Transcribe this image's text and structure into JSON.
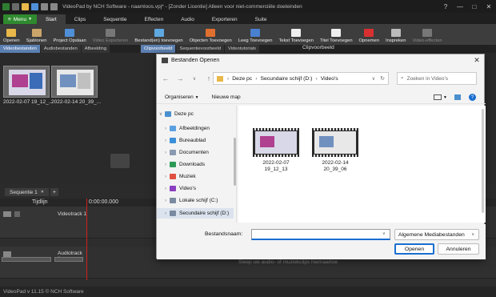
{
  "window": {
    "title": "VideoPad by NCH Software - naamloos.vpj* - [Zonder Licentie] Alleen voor niet-commerciële doeleinden",
    "controls": [
      "?",
      "—",
      "□",
      "✕"
    ]
  },
  "menubar": {
    "menu_label": "Menu",
    "tabs": [
      "Start",
      "Clips",
      "Sequentie",
      "Effecten",
      "Audio",
      "Exporteren",
      "Suite"
    ],
    "active_tab": "Start"
  },
  "toolbar": {
    "items": [
      {
        "label": "Openen",
        "icon": "folder-icon",
        "color": "#e8b84a",
        "enabled": true
      },
      {
        "label": "Sjablonen",
        "icon": "templates-icon",
        "color": "#c9a56a",
        "enabled": true
      },
      {
        "label": "Project Opslaan",
        "icon": "save-icon",
        "color": "#4f8fd8",
        "enabled": true
      },
      {
        "label": "Video Exporteren",
        "icon": "export-icon",
        "color": "#777777",
        "enabled": false
      },
      {
        "label": "Bestand(en) toevoegen",
        "icon": "add-files-icon",
        "color": "#5fa8e0",
        "enabled": true
      },
      {
        "label": "Objecten Toevoegen",
        "icon": "objects-icon",
        "color": "#e07030",
        "enabled": true
      },
      {
        "label": "Leeg Toevoegen",
        "icon": "blank-icon",
        "color": "#4a80d0",
        "enabled": true
      },
      {
        "label": "Tekst Toevoegen",
        "icon": "text-icon",
        "color": "#eeeeee",
        "enabled": true
      },
      {
        "label": "Titel Toevoegen",
        "icon": "title-icon",
        "color": "#eeeeee",
        "enabled": true
      },
      {
        "label": "Opnemen",
        "icon": "record-icon",
        "color": "#d83030",
        "enabled": true
      },
      {
        "label": "Inspreken",
        "icon": "microphone-icon",
        "color": "#bbbbbb",
        "enabled": true
      },
      {
        "label": "Video-effecten",
        "icon": "video-effects-icon",
        "color": "#777777",
        "enabled": false
      }
    ]
  },
  "bin": {
    "tabs": [
      "Videobestanden",
      "Audiobestanden",
      "Afbeelding"
    ],
    "active_tab": "Videobestanden",
    "clips": [
      {
        "label": "2022-02-07 19_12_..."
      },
      {
        "label": "2022-02-14 20_39_..."
      }
    ]
  },
  "preview": {
    "tabs": [
      "Clipvoorbeeld",
      "Sequentievoorbeeld",
      "Videotutorials"
    ],
    "active_tab": "Clipvoorbeeld",
    "title": "Clipvoorbeeld"
  },
  "timeline": {
    "sequence_tab": "Sequentie 1",
    "add_tab": "+",
    "ruler_label": "Tijdlijn",
    "time_start": "0:00:00.000",
    "video_track": "Videotrack 1",
    "audio_track": "Audiotrack 1",
    "audio_hint": "Sleep uw audio- of muziekclips hiernaartoe"
  },
  "status": {
    "text": "VideoPad v 11.15 © NCH Software"
  },
  "dialog": {
    "title": "Bestanden Openen",
    "breadcrumb": [
      "Deze pc",
      "Secundaire schijf (D:)",
      "Video's"
    ],
    "search_placeholder": "Zoeken in Video's",
    "commands": {
      "organize": "Organiseren",
      "new_folder": "Nieuwe map"
    },
    "nav": [
      {
        "label": "Deze pc",
        "icon": "computer-icon",
        "color": "#4a90d0",
        "level": 0,
        "expanded": true
      },
      {
        "label": "Afbeeldingen",
        "icon": "pictures-icon",
        "color": "#5aa0e0",
        "level": 1
      },
      {
        "label": "Bureaublad",
        "icon": "desktop-icon",
        "color": "#3c8fd8",
        "level": 1
      },
      {
        "label": "Documenten",
        "icon": "documents-icon",
        "color": "#8a9ab0",
        "level": 1
      },
      {
        "label": "Downloads",
        "icon": "downloads-icon",
        "color": "#2e9a58",
        "level": 1
      },
      {
        "label": "Muziek",
        "icon": "music-icon",
        "color": "#e05040",
        "level": 1
      },
      {
        "label": "Video's",
        "icon": "videos-icon",
        "color": "#8a40c0",
        "level": 1
      },
      {
        "label": "Lokale schijf (C:)",
        "icon": "drive-icon",
        "color": "#7a8aa0",
        "level": 1
      },
      {
        "label": "Secundaire schijf (D:)",
        "icon": "drive-icon",
        "color": "#7a8aa0",
        "level": 1,
        "selected": true
      }
    ],
    "files": [
      {
        "name_line1": "2022-02-07",
        "name_line2": "19_12_13"
      },
      {
        "name_line1": "2022-02-14",
        "name_line2": "20_39_06"
      }
    ],
    "filename_label": "Bestandsnaam:",
    "filename_value": "",
    "filetype": "Algemene Mediabestanden",
    "open_button": "Openen",
    "cancel_button": "Annuleren"
  }
}
